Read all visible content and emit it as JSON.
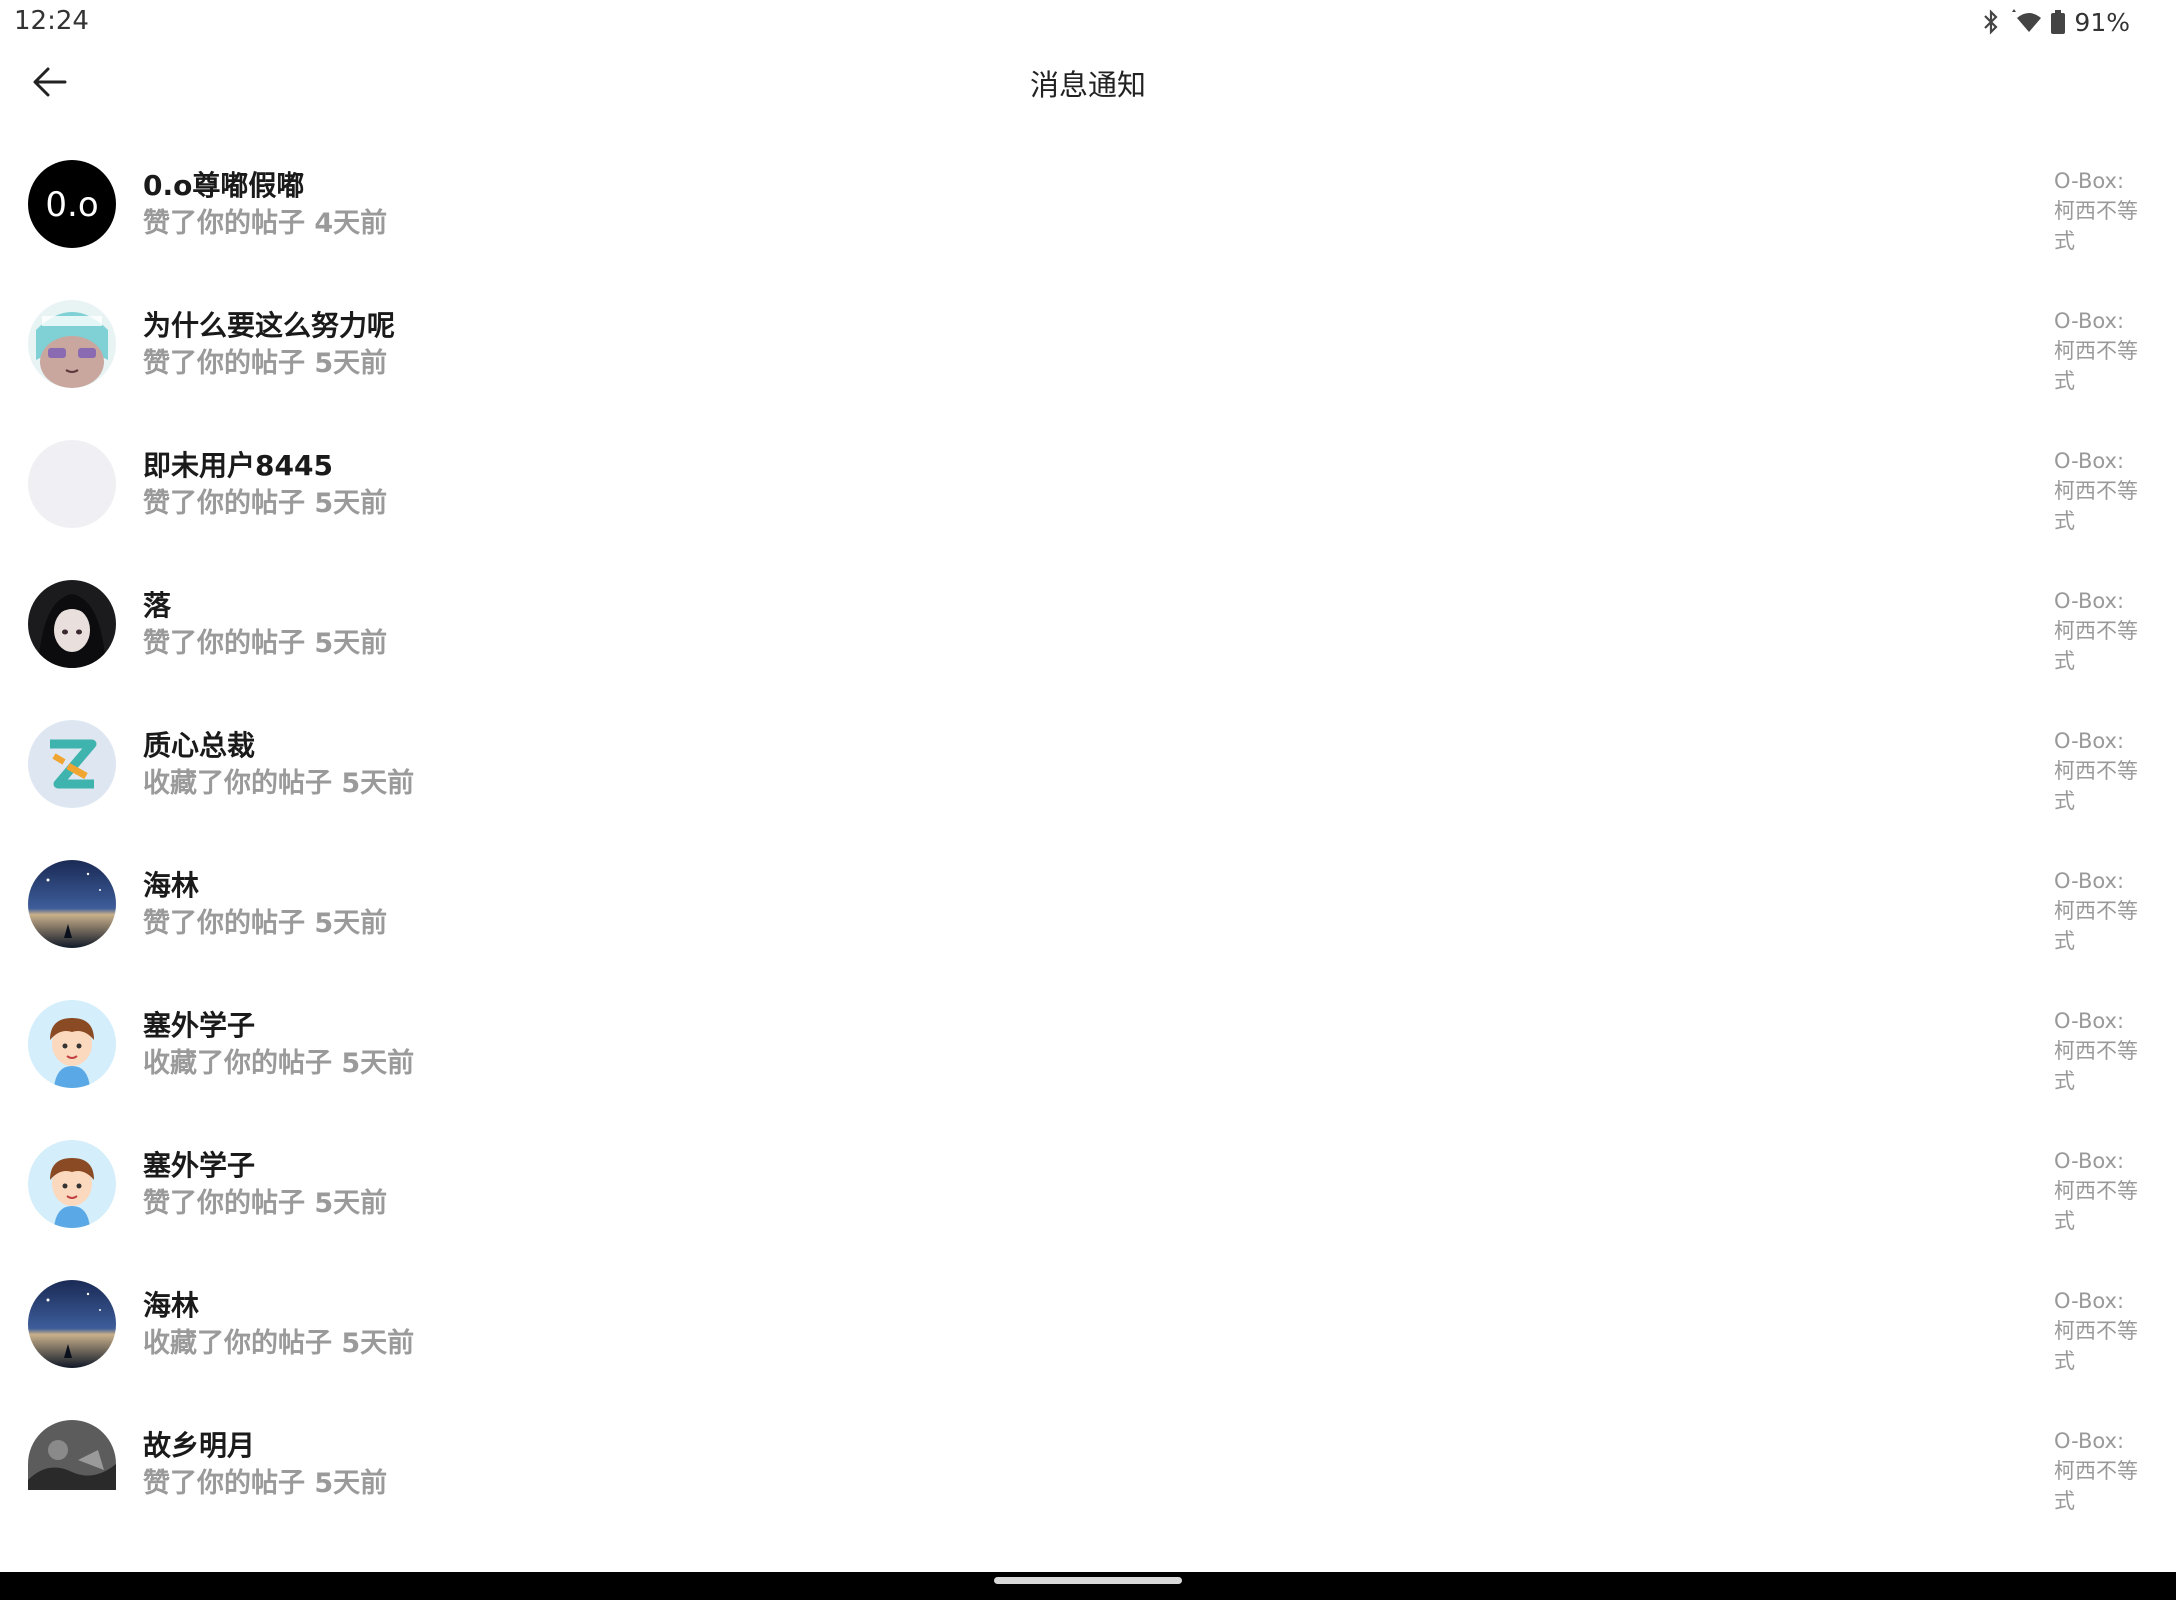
{
  "status_bar": {
    "time": "12:24",
    "battery": "91%"
  },
  "header": {
    "title": "消息通知"
  },
  "notifications": [
    {
      "name": "0.o尊嘟假嘟",
      "action": "赞了你的帖子 4天前",
      "post": "O-Box:柯西不等式",
      "avatar": "text-avatar",
      "avatar_text": "0.o"
    },
    {
      "name": "为什么要这么努力呢",
      "action": "赞了你的帖子 5天前",
      "post": "O-Box:柯西不等式",
      "avatar": "anime-teal-hair"
    },
    {
      "name": "即未用户8445",
      "action": "赞了你的帖子 5天前",
      "post": "O-Box:柯西不等式",
      "avatar": "blank"
    },
    {
      "name": "落",
      "action": "赞了你的帖子 5天前",
      "post": "O-Box:柯西不等式",
      "avatar": "anime-dark-hair"
    },
    {
      "name": "质心总裁",
      "action": "收藏了你的帖子 5天前",
      "post": "O-Box:柯西不等式",
      "avatar": "z-logo"
    },
    {
      "name": "海林",
      "action": "赞了你的帖子 5天前",
      "post": "O-Box:柯西不等式",
      "avatar": "night-sky"
    },
    {
      "name": "塞外学子",
      "action": "收藏了你的帖子 5天前",
      "post": "O-Box:柯西不等式",
      "avatar": "cartoon-boy"
    },
    {
      "name": "塞外学子",
      "action": "赞了你的帖子 5天前",
      "post": "O-Box:柯西不等式",
      "avatar": "cartoon-boy"
    },
    {
      "name": "海林",
      "action": "收藏了你的帖子 5天前",
      "post": "O-Box:柯西不等式",
      "avatar": "night-sky"
    },
    {
      "name": "故乡明月",
      "action": "赞了你的帖子 5天前",
      "post": "O-Box:柯西不等式",
      "avatar": "grayscale-scene"
    }
  ],
  "colors": {
    "name": "#1a1a1a",
    "secondary": "#9a9a9a",
    "background": "#ffffff"
  }
}
